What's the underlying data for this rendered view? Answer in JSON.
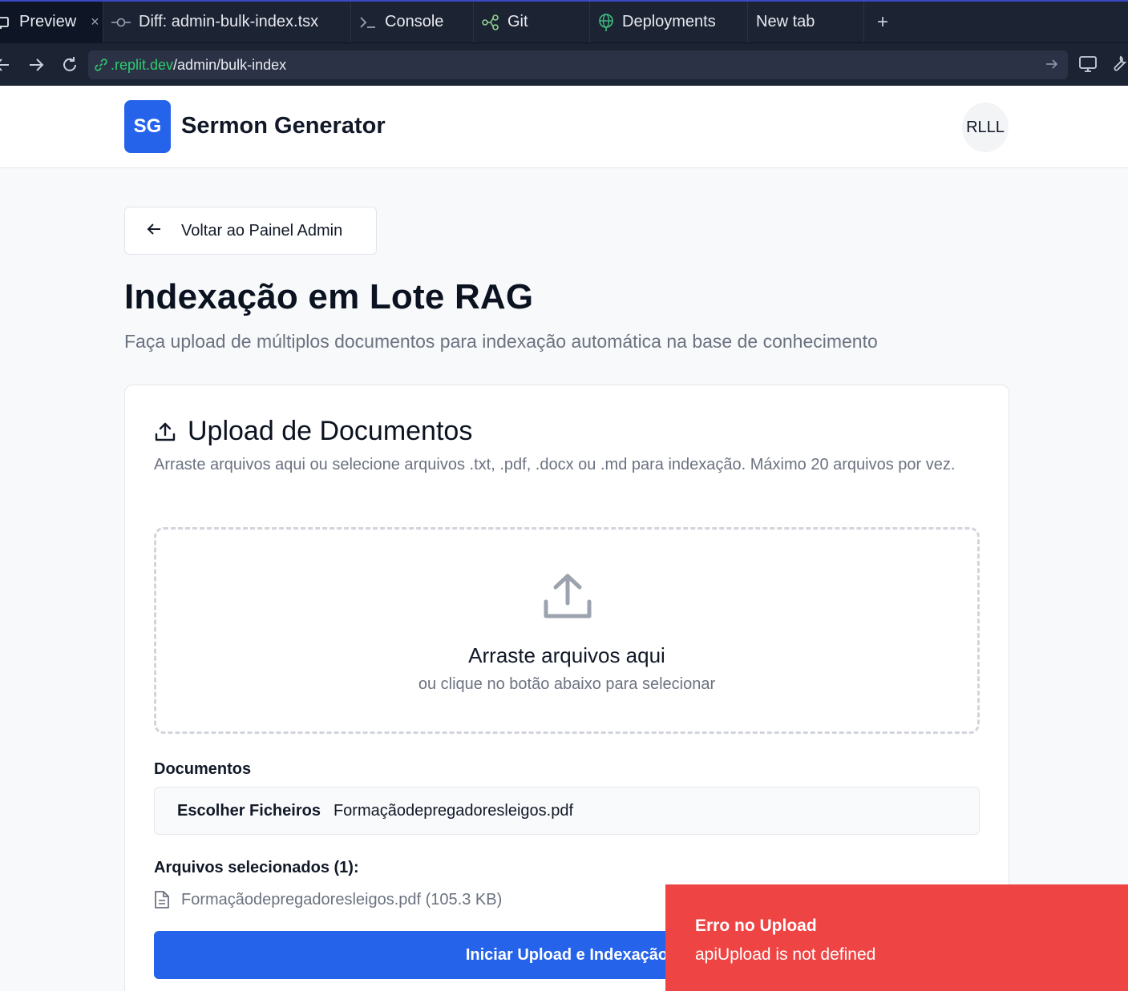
{
  "browser": {
    "tabs": [
      {
        "label": "Preview",
        "icon": "preview-icon",
        "close": "×"
      },
      {
        "label": "Diff: admin-bulk-index.tsx",
        "icon": "commit-icon"
      },
      {
        "label": "Console",
        "icon": "terminal-icon"
      },
      {
        "label": "Git",
        "icon": "git-icon"
      },
      {
        "label": "Deployments",
        "icon": "globe-icon"
      },
      {
        "label": "New tab"
      }
    ],
    "new_tab": "+",
    "url_domain": ".replit.dev",
    "url_path": "/admin/bulk-index"
  },
  "app": {
    "logo": "SG",
    "name": "Sermon Generator",
    "avatar": "RLLL"
  },
  "page": {
    "back_label": "Voltar ao Painel Admin",
    "title": "Indexação em Lote RAG",
    "subtitle": "Faça upload de múltiplos documentos para indexação automática na base de conhecimento"
  },
  "card": {
    "title": "Upload de Documentos",
    "description": "Arraste arquivos aqui ou selecione arquivos .txt, .pdf, .docx ou .md para indexação. Máximo 20 arquivos por vez.",
    "dropzone_title": "Arraste arquivos aqui",
    "dropzone_sub": "ou clique no botão abaixo para selecionar",
    "documents_label": "Documentos",
    "choose_files": "Escolher Ficheiros",
    "chosen_file": "Formaçãodepregadoresleigos.pdf",
    "selected_label": "Arquivos selecionados (1):",
    "selected_files": [
      "Formaçãodepregadoresleigos.pdf (105.3 KB)"
    ],
    "start_button": "Iniciar Upload e Indexação"
  },
  "toast": {
    "title": "Erro no Upload",
    "message": "apiUpload is not defined",
    "color": "#ef4444"
  },
  "colors": {
    "primary": "#2563eb",
    "chrome": "#1c2333",
    "url_domain": "#2ecc71"
  }
}
